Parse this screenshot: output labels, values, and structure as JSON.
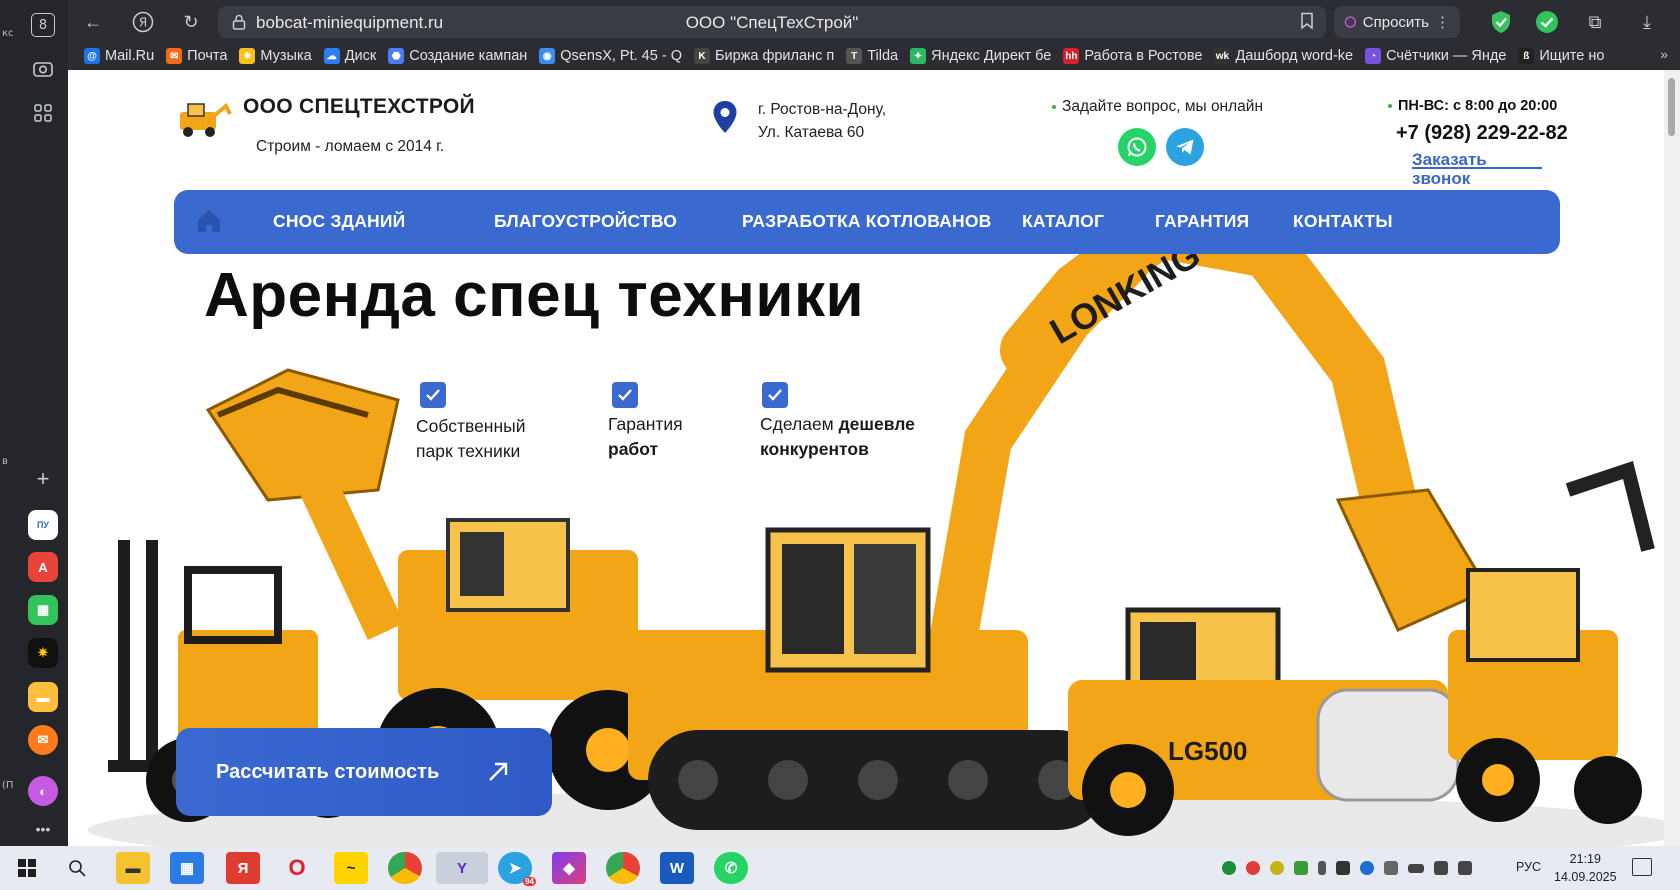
{
  "browser": {
    "tab_counter": "8",
    "url": "bobcat-miniequipment.ru",
    "page_title": "ООО \"СпецТехСтрой\"",
    "ask_label": "Спросить",
    "bookmarks": [
      {
        "label": "Mail.Ru",
        "color": "#1e73e8",
        "glyph": "@"
      },
      {
        "label": "Почта",
        "color": "#f46a1b",
        "glyph": "✉"
      },
      {
        "label": "Музыка",
        "color": "#f7c21f",
        "glyph": "✷"
      },
      {
        "label": "Диск",
        "color": "#2f7bf5",
        "glyph": "☁"
      },
      {
        "label": "Создание кампан",
        "color": "#4a7cf2",
        "glyph": "⬣"
      },
      {
        "label": "QsensX, Pt. 45 - Q",
        "color": "#3b8df0",
        "glyph": "◉"
      },
      {
        "label": "Биржа фриланс п",
        "color": "#444",
        "glyph": "K"
      },
      {
        "label": "Tilda",
        "color": "#555",
        "glyph": "T"
      },
      {
        "label": "Яндекс Директ бе",
        "color": "#2fb864",
        "glyph": "✦"
      },
      {
        "label": "Работа в Ростове",
        "color": "#d8202f",
        "glyph": "hh"
      },
      {
        "label": "Дашборд word-ke",
        "color": "#333",
        "glyph": "wk"
      },
      {
        "label": "Счётчики — Янде",
        "color": "#7a52e0",
        "glyph": "◔"
      },
      {
        "label": "Ищите но",
        "color": "#222",
        "glyph": "ß"
      }
    ]
  },
  "site": {
    "company_name": "ООО СПЕЦТЕХСТРОЙ",
    "slogan": "Строим - ломаем с 2014 г.",
    "address_line1": "г. Ростов-на-Дону,",
    "address_line2": "Ул. Катаева 60",
    "online_text": "Задайте вопрос, мы онлайн",
    "hours": "ПН-ВС: с 8:00 до 20:00",
    "phone": "+7 (928) 229-22-82",
    "callback_line1": "Заказать",
    "callback_line2": "звонок",
    "nav": [
      "СНОС ЗДАНИЙ",
      "БЛАГОУСТРОЙСТВО",
      "РАЗРАБОТКА КОТЛОВАНОВ",
      "КАТАЛОГ",
      "ГАРАНТИЯ",
      "КОНТАКТЫ"
    ],
    "hero_title": "Аренда спец техники",
    "features": [
      {
        "line1": "Собственный",
        "line2": "парк техники",
        "bold2": false
      },
      {
        "line1": "Гарантия",
        "line2": "работ",
        "bold2": true
      },
      {
        "line1_plain": "Сделаем ",
        "line1_bold": "дешевле",
        "line2": "конкурентов",
        "bold2": true
      }
    ],
    "cta_label": "Рассчитать стоимость",
    "excavator_brand": "LONKING",
    "roller_model": "LG500"
  },
  "taskbar": {
    "lang": "РУС",
    "time": "21:19",
    "date": "14.09.2025",
    "telegram_badge": "94"
  },
  "colors": {
    "accent": "#3a69d0",
    "machine_yellow": "#f2a516",
    "whatsapp": "#25d366",
    "telegram": "#2aa3e0"
  }
}
